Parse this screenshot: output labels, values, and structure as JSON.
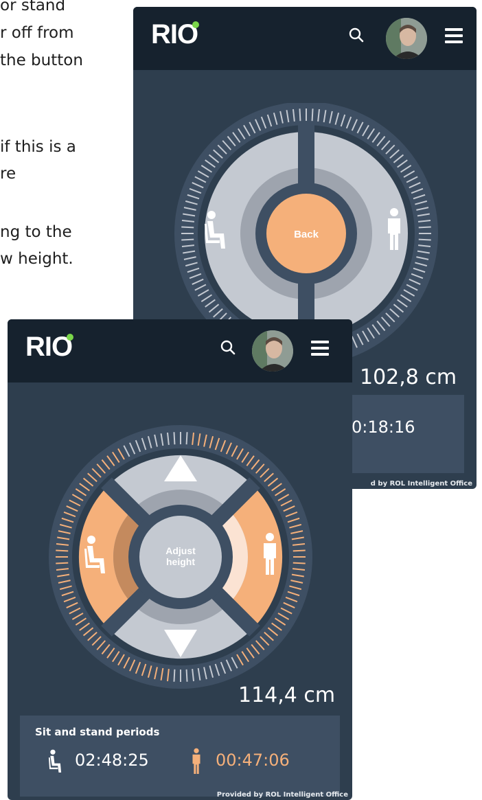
{
  "background_text": {
    "lines": [
      "or stand",
      "r off from",
      "the button",
      "if this is a",
      "re",
      "ng to the",
      "w height."
    ]
  },
  "logo": "RIO",
  "colors": {
    "logo_dot": "#7ad64a",
    "accent": "#f5b07a",
    "header": "#16222e",
    "panel": "#3e4f63",
    "dial_grey": "#c4c9d1"
  },
  "icons": {
    "search": "search-icon",
    "menu": "hamburger-menu-icon",
    "sit": "sitting-person-icon",
    "stand": "standing-person-icon",
    "up": "arrow-up-icon",
    "down": "arrow-down-icon"
  },
  "back_screen": {
    "center_button": "Back",
    "height_reading": "102,8 cm",
    "stand_time": "0:18:16",
    "credit": "d by ROL Intelligent Office"
  },
  "front_screen": {
    "center_button_line1": "Adjust",
    "center_button_line2": "height",
    "height_reading": "114,4 cm",
    "panel_title": "Sit and stand periods",
    "sit_time": "02:48:25",
    "stand_time": "00:47:06",
    "credit": "Provided by ROL Intelligent Office"
  }
}
